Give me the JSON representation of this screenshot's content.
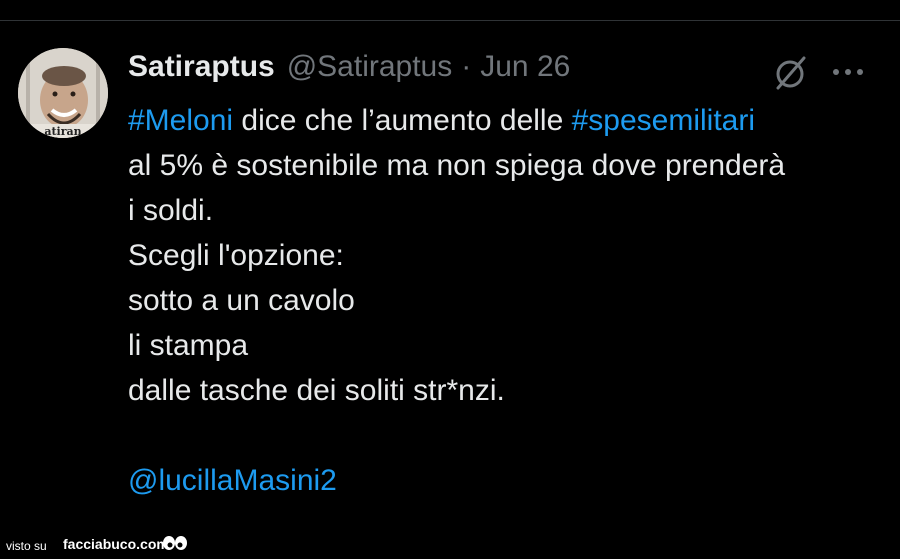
{
  "tweet": {
    "author_name": "Satiraptus",
    "author_handle": "@Satiraptus",
    "separator": "·",
    "date": "Jun 26",
    "avatar_caption": "atiran",
    "hashtag_1": "#Meloni",
    "text_1a": " dice che l’aumento delle ",
    "hashtag_2": "#spesemilitari",
    "line_2": "al 5% è sostenibile ma non spiega dove prenderà",
    "line_3": "i soldi.",
    "line_4": "Scegli l'opzione:",
    "line_5": "sotto a un cavolo",
    "line_6": "li stampa",
    "line_7": "dalle tasche dei soliti str*nzi.",
    "mention": "@lucillaMasini2"
  },
  "icons": {
    "grok": "grok-icon",
    "more": "more-options-icon"
  },
  "watermark": {
    "prefix": "visto su",
    "brand": "facciabuco.com"
  },
  "colors": {
    "background": "#000000",
    "text": "#e7e9ea",
    "muted": "#71767b",
    "link": "#1d9bf0"
  }
}
